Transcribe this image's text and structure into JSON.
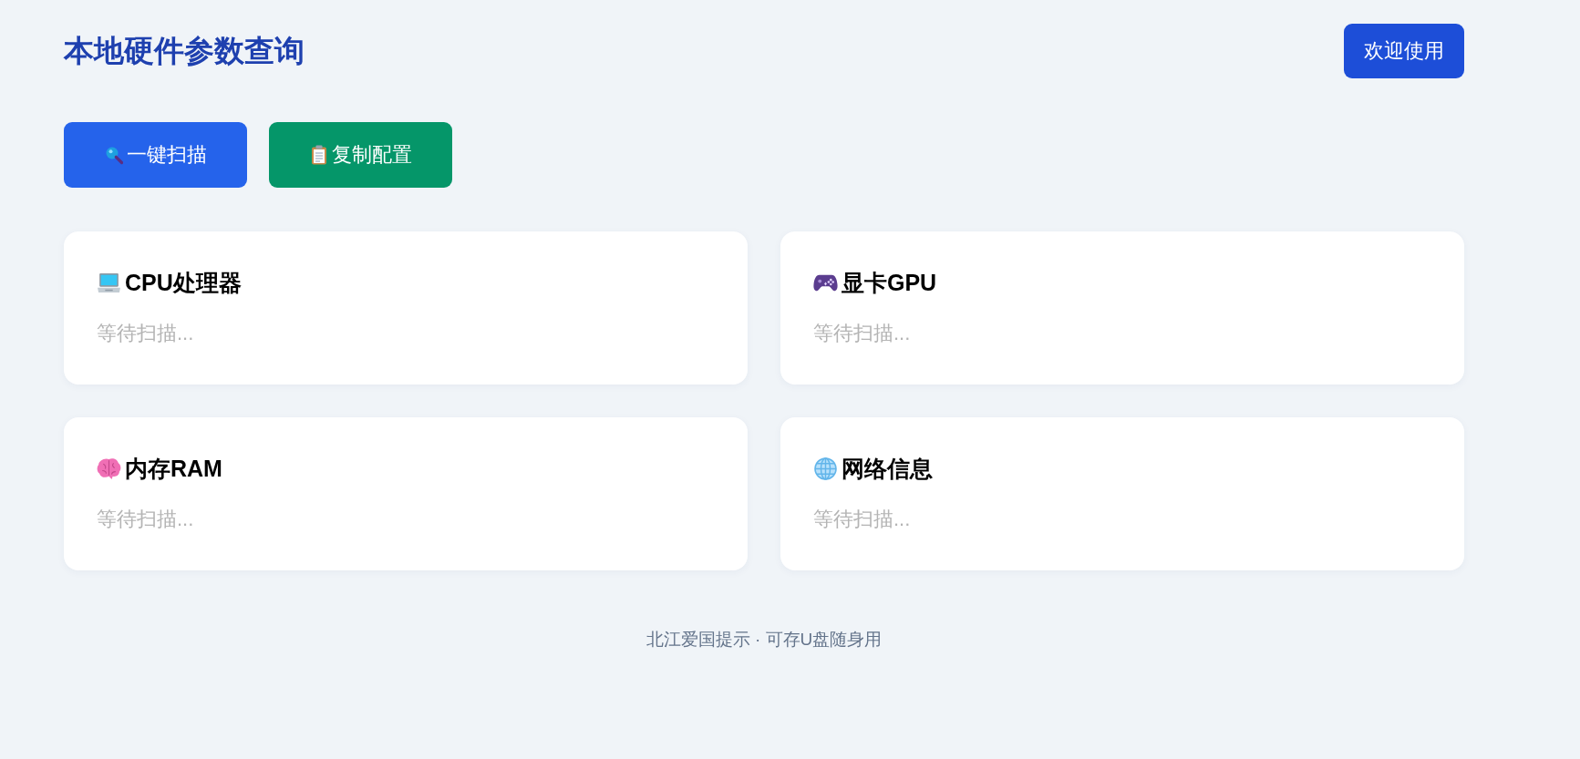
{
  "header": {
    "title": "本地硬件参数查询",
    "welcome_button": {
      "label": "欢迎使用"
    }
  },
  "scan_button": {
    "label": "一键扫描"
  },
  "copy_button": {
    "label": "复制配置"
  },
  "cards": [
    {
      "title": "CPU处理器",
      "status": "等待扫描..."
    },
    {
      "title": "显卡GPU",
      "status": "等待扫描..."
    },
    {
      "title": "内存RAM",
      "status": "等待扫描..."
    },
    {
      "title": "网络信息",
      "status": "等待扫描..."
    }
  ],
  "footer": {
    "text": "北江爱国提示 · 可存U盘随身用"
  }
}
